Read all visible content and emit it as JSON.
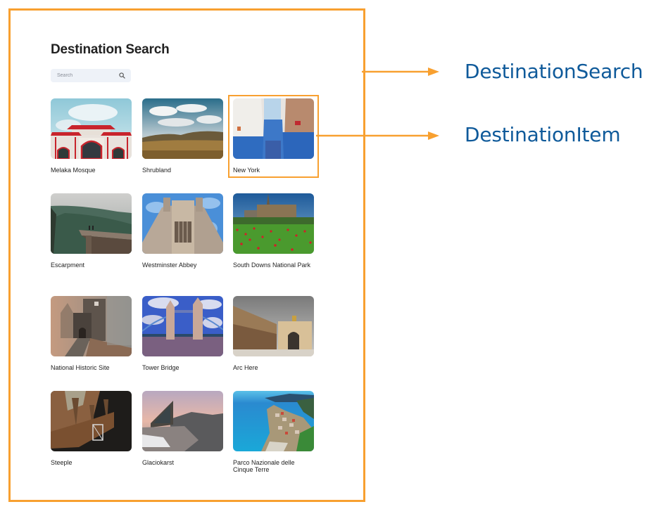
{
  "app": {
    "title": "Destination Search",
    "search": {
      "placeholder": "Search",
      "value": "",
      "icon": "search-icon"
    }
  },
  "destinations": [
    {
      "label": "Melaka Mosque",
      "scene": "temple"
    },
    {
      "label": "Shrubland",
      "scene": "savanna"
    },
    {
      "label": "New York",
      "scene": "blue-alley"
    },
    {
      "label": "Escarpment",
      "scene": "cliff"
    },
    {
      "label": "Westminster Abbey",
      "scene": "cathedral"
    },
    {
      "label": "South Downs National Park",
      "scene": "castle-field"
    },
    {
      "label": "National Historic Site",
      "scene": "foggy-castle"
    },
    {
      "label": "Tower Bridge",
      "scene": "bridge"
    },
    {
      "label": "Arc Here",
      "scene": "plaza"
    },
    {
      "label": "Steeple",
      "scene": "aerial-towers"
    },
    {
      "label": "Glaciokarst",
      "scene": "mountain-cabin"
    },
    {
      "label": "Parco Nazionale delle Cinque Terre",
      "scene": "coast-village"
    }
  ],
  "annotations": {
    "highlight_color": "#f8a030",
    "label_color": "#0f5a9a",
    "callouts": [
      {
        "label": "DestinationSearch",
        "target": "page"
      },
      {
        "label": "DestinationItem",
        "target": "destination-card-3"
      }
    ]
  }
}
